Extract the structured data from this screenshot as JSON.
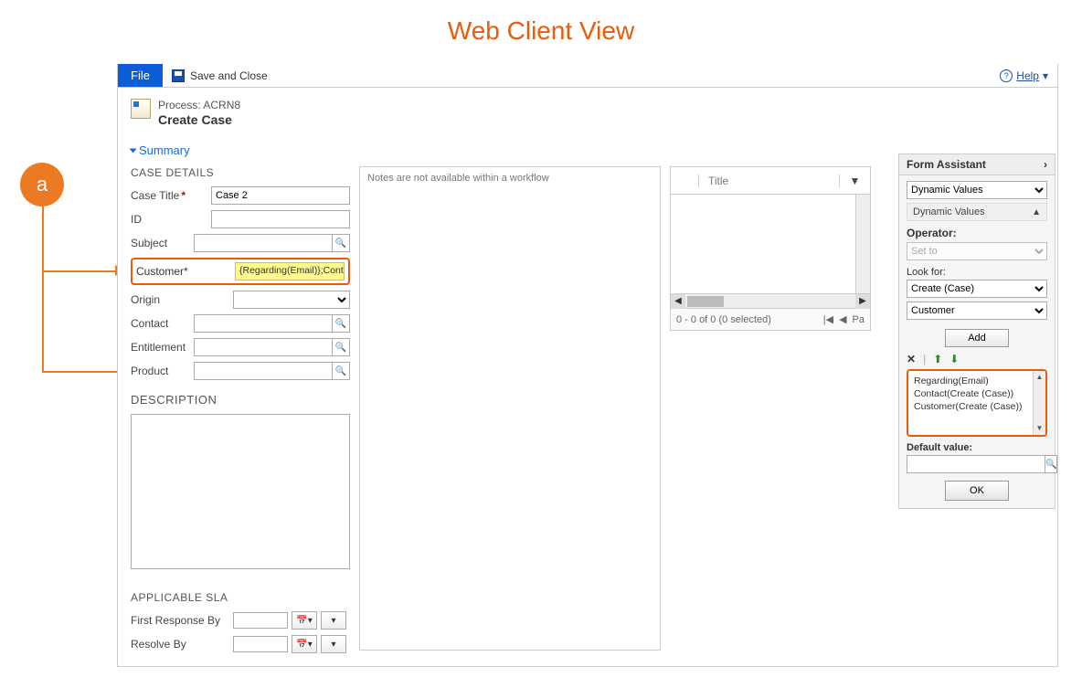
{
  "page_title": "Web Client View",
  "annotation": {
    "badge": "a"
  },
  "toolbar": {
    "file_label": "File",
    "save_close_label": "Save and Close",
    "help_label": "Help"
  },
  "header": {
    "process_label": "Process: ACRN8",
    "entity_title": "Create Case",
    "summary_label": "Summary"
  },
  "left": {
    "case_details_heading": "CASE DETAILS",
    "fields": {
      "case_title_label": "Case Title",
      "case_title_value": "Case 2",
      "id_label": "ID",
      "id_value": "",
      "subject_label": "Subject",
      "subject_value": "",
      "customer_label": "Customer",
      "customer_value": "{Regarding(Email)};Contact(Cr",
      "origin_label": "Origin",
      "contact_label": "Contact",
      "entitlement_label": "Entitlement",
      "product_label": "Product"
    },
    "description_heading": "DESCRIPTION",
    "sla_heading": "APPLICABLE SLA",
    "sla": {
      "first_response_label": "First Response By",
      "resolve_by_label": "Resolve By"
    }
  },
  "notes": {
    "placeholder": "Notes are not available within a workflow"
  },
  "grid": {
    "title_header": "Title",
    "footer_status": "0 - 0 of 0 (0 selected)",
    "page_label": "Pa"
  },
  "form_assistant": {
    "title": "Form Assistant",
    "top_select": "Dynamic Values",
    "section_label": "Dynamic Values",
    "operator_label": "Operator:",
    "operator_value": "Set to",
    "lookfor_label": "Look for:",
    "lookfor1": "Create (Case)",
    "lookfor2": "Customer",
    "add_btn": "Add",
    "list_items": [
      "Regarding(Email)",
      "Contact(Create (Case))",
      "Customer(Create (Case))"
    ],
    "default_value_label": "Default value:",
    "ok_btn": "OK"
  }
}
